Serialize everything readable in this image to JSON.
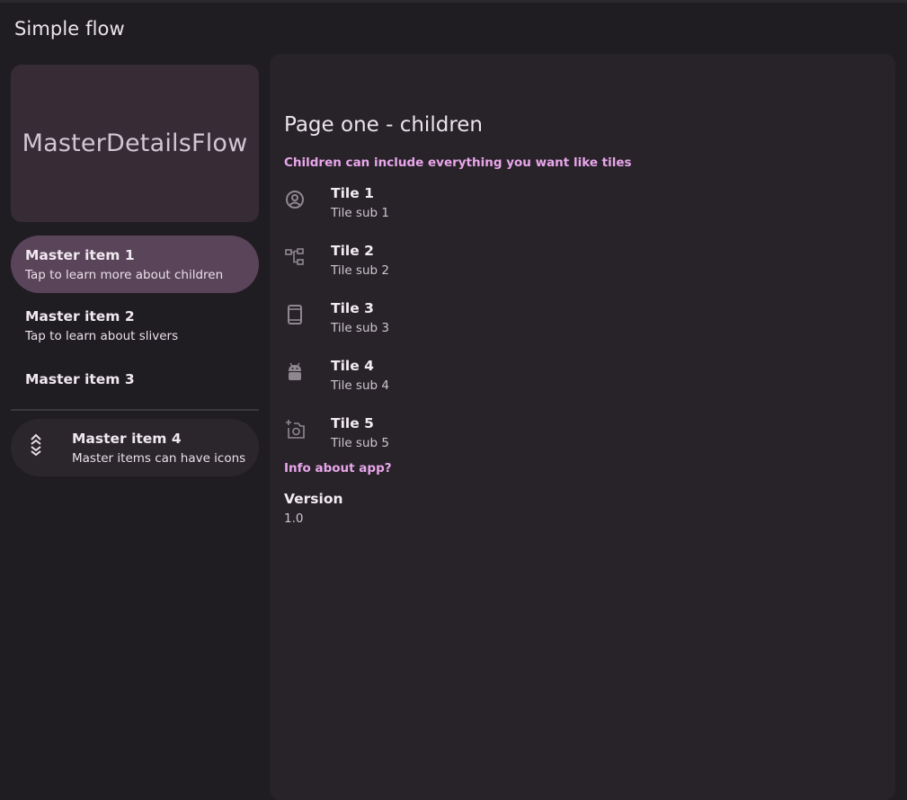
{
  "app": {
    "title": "Simple flow"
  },
  "master": {
    "header_title": "MasterDetailsFlow",
    "items": [
      {
        "title": "Master item 1",
        "subtitle": "Tap to learn more about children",
        "selected": true
      },
      {
        "title": "Master item 2",
        "subtitle": "Tap to learn about slivers"
      },
      {
        "title": "Master item 3"
      },
      {
        "title": "Master item 4",
        "subtitle": "Master items can have icons",
        "icon": "double-chevron-up-down-icon"
      }
    ]
  },
  "details": {
    "page_title": "Page one - children",
    "section_children": "Children can include everything you want like tiles",
    "tiles": [
      {
        "title": "Tile 1",
        "subtitle": "Tile sub 1",
        "icon": "account-circle-icon"
      },
      {
        "title": "Tile 2",
        "subtitle": "Tile sub 2",
        "icon": "account-tree-icon"
      },
      {
        "title": "Tile 3",
        "subtitle": "Tile sub 3",
        "icon": "phone-device-icon"
      },
      {
        "title": "Tile 4",
        "subtitle": "Tile sub 4",
        "icon": "android-icon"
      },
      {
        "title": "Tile 5",
        "subtitle": "Tile sub 5",
        "icon": "add-a-photo-icon"
      }
    ],
    "section_info": "Info about app?",
    "version": {
      "title": "Version",
      "value": "1.0"
    }
  },
  "colors": {
    "background": "#201d22",
    "surface": "#272329",
    "header_card": "#372b36",
    "selected_item": "#5a4459",
    "accent": "#e9a6ea"
  }
}
